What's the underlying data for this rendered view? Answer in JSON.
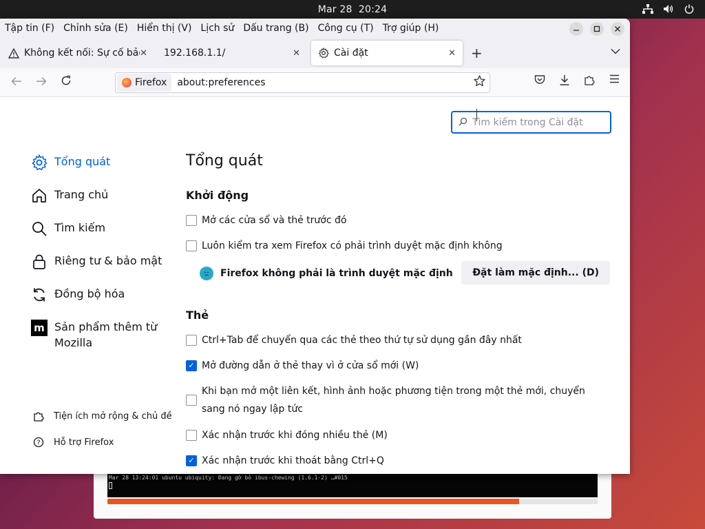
{
  "topbar": {
    "date": "Mar 28",
    "time": "20:24"
  },
  "installer": {
    "terminal_line": "Mar 28 13:24:01 ubuntu ubiquity: Đang gỡ bỏ ibus-chewing (1.6.1-2) …#015",
    "progress": 0.84
  },
  "menubar": {
    "items": [
      "Tập tin (F)",
      "Chỉnh sửa (E)",
      "Hiển thị (V)",
      "Lịch sử",
      "Dấu trang (B)",
      "Công cụ (T)",
      "Trợ giúp (H)"
    ]
  },
  "tabs": [
    {
      "label": "Không kết nối: Sự cố bảo",
      "icon": "warning-icon"
    },
    {
      "label": "192.168.1.1/",
      "icon": ""
    },
    {
      "label": "Cài đặt",
      "icon": "gear-icon",
      "active": true
    }
  ],
  "navbar": {
    "identity": "Firefox",
    "url": "about:preferences"
  },
  "search": {
    "placeholder": "Tìm kiếm trong Cài đặt"
  },
  "sidebar": {
    "items": [
      {
        "label": "Tổng quát",
        "icon": "gear-icon",
        "active": true
      },
      {
        "label": "Trang chủ",
        "icon": "home-icon"
      },
      {
        "label": "Tìm kiếm",
        "icon": "search-icon"
      },
      {
        "label": "Riêng tư & bảo mật",
        "icon": "lock-icon"
      },
      {
        "label": "Đồng bộ hóa",
        "icon": "sync-icon"
      },
      {
        "label": "Sản phẩm thêm từ Mozilla",
        "icon": "mozilla-icon"
      }
    ],
    "footer": [
      {
        "label": "Tiện ích mở rộng & chủ đề",
        "icon": "puzzle-icon"
      },
      {
        "label": "Hỗ trợ Firefox",
        "icon": "help-icon"
      }
    ]
  },
  "main": {
    "title": "Tổng quát",
    "startup": {
      "heading": "Khởi động",
      "options": [
        {
          "label": "Mở các cửa sổ và thẻ trước đó",
          "checked": false
        },
        {
          "label": "Luôn kiểm tra xem Firefox có phải trình duyệt mặc định không",
          "checked": false
        }
      ],
      "not_default": "Firefox không phải là trình duyệt mặc định",
      "make_default_button": "Đặt làm mặc định... (D)"
    },
    "tabs_section": {
      "heading": "Thẻ",
      "options": [
        {
          "label": "Ctrl+Tab để chuyển qua các thẻ theo thứ tự sử dụng gần đây nhất",
          "checked": false
        },
        {
          "label": "Mở đường dẫn ở thẻ thay vì ở cửa sổ mới (W)",
          "checked": true
        },
        {
          "label": "Khi bạn mở một liên kết, hình ảnh hoặc phương tiện trong một thẻ mới, chuyển sang nó ngay lập tức",
          "checked": false
        },
        {
          "label": "Xác nhận trước khi đóng nhiều thẻ (M)",
          "checked": false
        },
        {
          "label": "Xác nhận trước khi thoát bằng Ctrl+Q",
          "checked": true
        }
      ]
    }
  }
}
